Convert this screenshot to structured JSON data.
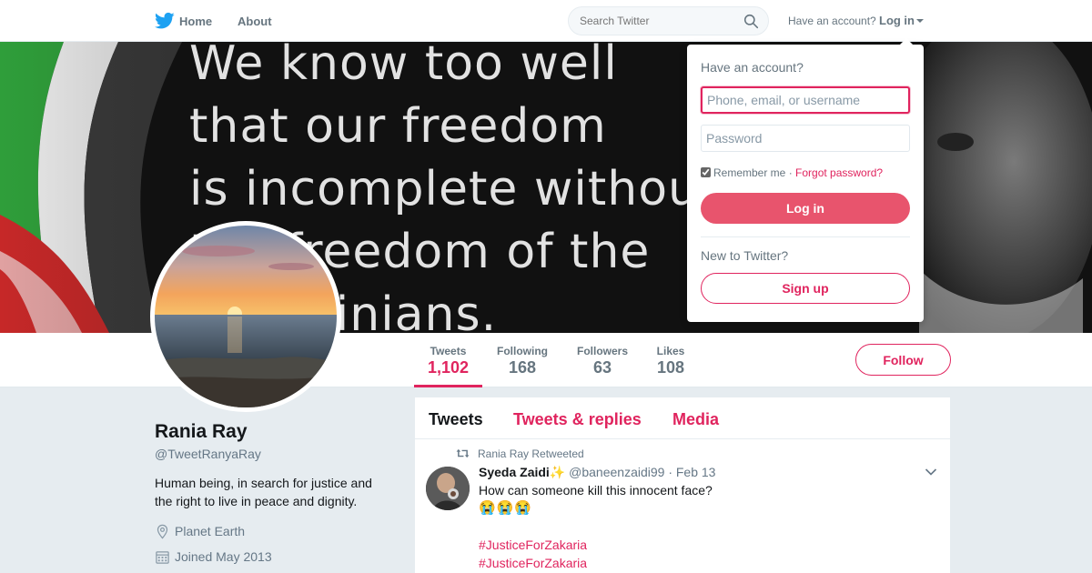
{
  "nav": {
    "home_label": "Home",
    "about_label": "About",
    "search_placeholder": "Search Twitter",
    "have_account_label": "Have an account?",
    "login_label": "Log in"
  },
  "banner": {
    "text_lines": [
      "We know too well",
      "that our freedom",
      "is incomplete without",
      "the freedom of the",
      "Palestinians."
    ]
  },
  "stats": {
    "tweets": {
      "label": "Tweets",
      "value": "1,102"
    },
    "following": {
      "label": "Following",
      "value": "168"
    },
    "followers": {
      "label": "Followers",
      "value": "63"
    },
    "likes": {
      "label": "Likes",
      "value": "108"
    }
  },
  "follow_label": "Follow",
  "profile": {
    "name": "Rania Ray",
    "handle": "@TweetRanyaRay",
    "bio": "Human being, in search for justice and the right to live in peace and dignity.",
    "location": "Planet Earth",
    "joined": "Joined May 2013"
  },
  "timeline": {
    "tabs": [
      "Tweets",
      "Tweets & replies",
      "Media"
    ],
    "tweet": {
      "retweet_label": "Rania Ray Retweeted",
      "author_name": "Syeda Zaidi",
      "author_emoji": "✨",
      "author_handle": "@baneenzaidi99",
      "date": "· Feb 13",
      "text": "How can someone kill this innocent face?",
      "emojis": "😭😭😭",
      "hashtags": [
        "#JusticeForZakaria",
        "#JusticeForZakaria"
      ]
    }
  },
  "login_dropdown": {
    "title": "Have an account?",
    "username_placeholder": "Phone, email, or username",
    "password_placeholder": "Password",
    "remember_label": "Remember me ·",
    "forgot_label": "Forgot password?",
    "login_button": "Log in",
    "new_label": "New to Twitter?",
    "signup_button": "Sign up"
  },
  "colors": {
    "accent": "#e0245e",
    "login_button": "#e8546d",
    "twitter_blue": "#1da1f2"
  }
}
